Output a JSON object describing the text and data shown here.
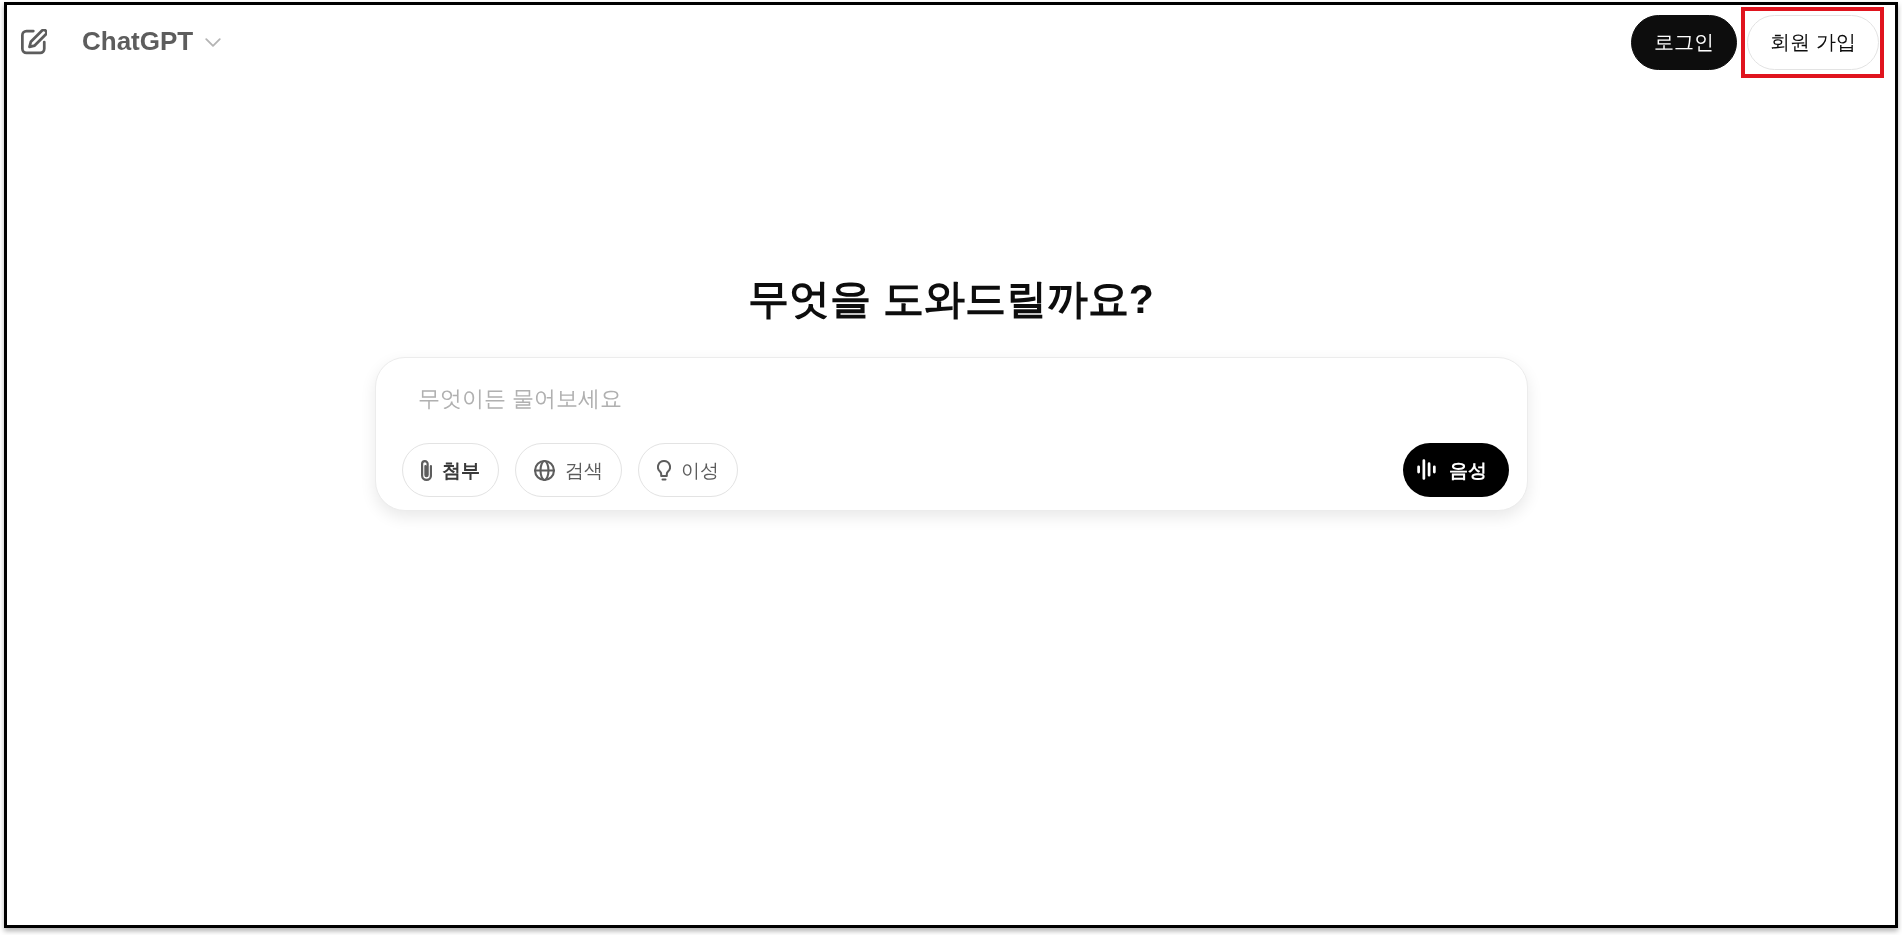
{
  "header": {
    "model_selector": {
      "label": "ChatGPT"
    },
    "buttons": [
      {
        "label": "로그인",
        "kind": "primary",
        "highlighted": false
      },
      {
        "label": "회원 가입",
        "kind": "secondary",
        "highlighted": true
      }
    ]
  },
  "main": {
    "heading": "무엇을 도와드릴까요?",
    "composer": {
      "placeholder": "무엇이든 물어보세요",
      "tools": [
        {
          "label": "첨부",
          "kind": "attach",
          "bold": true
        },
        {
          "label": "검색",
          "kind": "search",
          "bold": false
        },
        {
          "label": "이성",
          "kind": "reason",
          "bold": false
        }
      ],
      "voice_button": {
        "label": "음성"
      }
    }
  }
}
